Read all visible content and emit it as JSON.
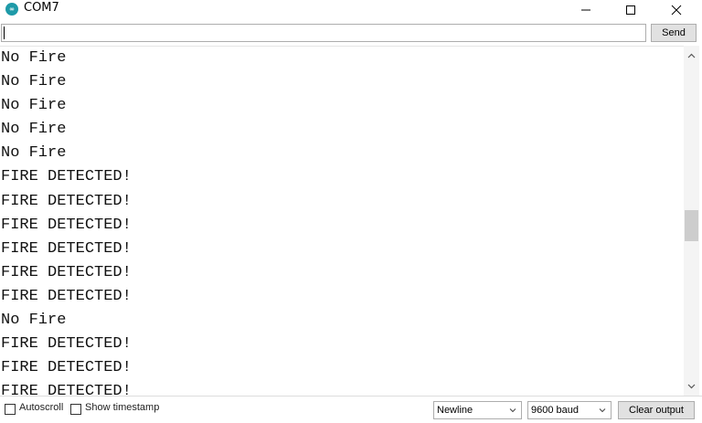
{
  "window": {
    "title": "COM7",
    "app_icon_text": "∞",
    "icons": [
      "arduino-icon",
      "minimize-icon",
      "maximize-icon",
      "close-icon"
    ]
  },
  "send_row": {
    "input_value": "",
    "send_label": "Send"
  },
  "output": {
    "lines": [
      "No Fire",
      "No Fire",
      "No Fire",
      "No Fire",
      "No Fire",
      "FIRE DETECTED!",
      "FIRE DETECTED!",
      "FIRE DETECTED!",
      "FIRE DETECTED!",
      "FIRE DETECTED!",
      "FIRE DETECTED!",
      "No Fire",
      "FIRE DETECTED!",
      "FIRE DETECTED!",
      "FIRE DETECTED!"
    ]
  },
  "bottom": {
    "autoscroll_label": "Autoscroll",
    "autoscroll_checked": false,
    "timestamp_label": "Show timestamp",
    "timestamp_checked": false,
    "line_ending": "Newline",
    "baud": "9600 baud",
    "clear_label": "Clear output"
  },
  "colors": {
    "app_icon": "#1e9aa8",
    "button_bg": "#e1e1e1",
    "scroll_thumb": "#cdcdcd"
  }
}
